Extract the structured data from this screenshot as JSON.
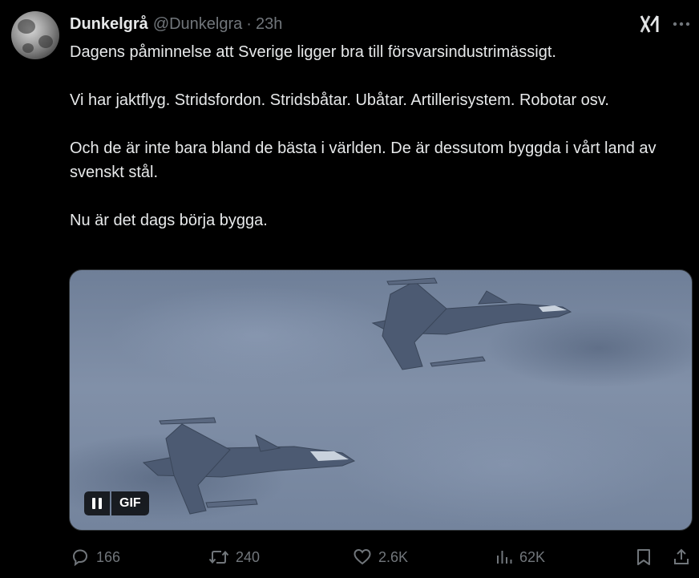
{
  "author": {
    "display_name": "Dunkelgrå",
    "handle": "@Dunkelgra",
    "separator": "·",
    "time": "23h"
  },
  "tweet": {
    "paragraphs": [
      "Dagens påminnelse att Sverige ligger bra till försvarsindustrimässigt.",
      "Vi har jaktflyg. Stridsfordon. Stridsbåtar. Ubåtar. Artillerisystem. Robotar osv.",
      "Och de är inte bara bland de bästa i världen. De är dessutom byggda i vårt land av svenskt stål.",
      "Nu är det dags börja bygga."
    ]
  },
  "media": {
    "type": "gif",
    "badge_label": "GIF",
    "pause_icon": "pause-icon",
    "subject": "two fighter jets in flight"
  },
  "actions": {
    "replies": "166",
    "reposts": "240",
    "likes": "2.6K",
    "views": "62K"
  },
  "icons": {
    "grok": "grok-icon",
    "more": "more-icon",
    "reply": "reply-icon",
    "repost": "repost-icon",
    "like": "heart-icon",
    "views": "views-icon",
    "bookmark": "bookmark-icon",
    "share": "share-icon"
  },
  "colors": {
    "background": "#000000",
    "text": "#e7e9ea",
    "muted": "#71767b"
  }
}
